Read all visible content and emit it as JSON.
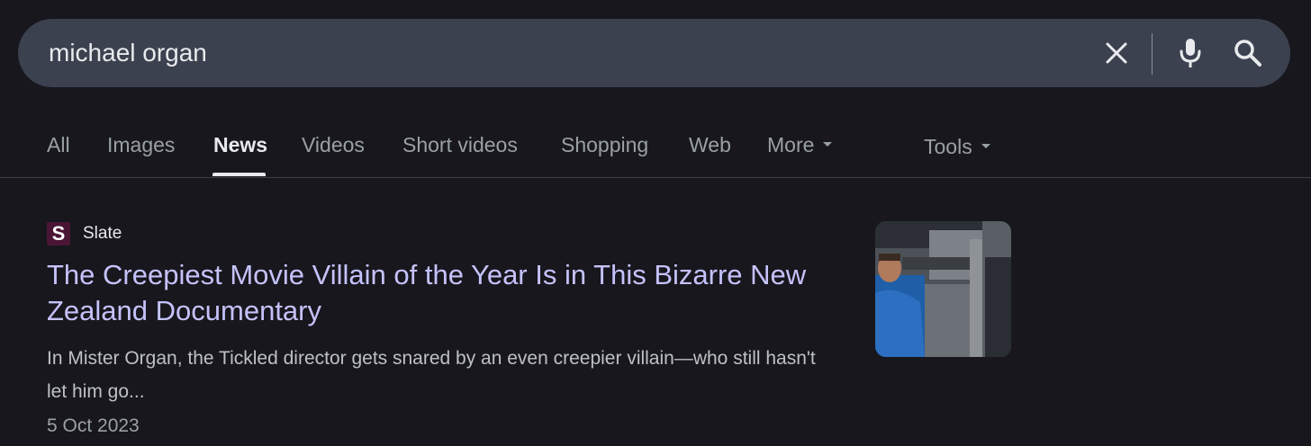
{
  "search": {
    "query": "michael organ",
    "clear_icon": "close-icon",
    "mic_icon": "microphone-icon",
    "search_icon": "search-icon"
  },
  "tabs": [
    {
      "label": "All",
      "active": false
    },
    {
      "label": "Images",
      "active": false
    },
    {
      "label": "News",
      "active": true
    },
    {
      "label": "Videos",
      "active": false
    },
    {
      "label": "Short videos",
      "active": false
    },
    {
      "label": "Shopping",
      "active": false
    },
    {
      "label": "Web",
      "active": false
    },
    {
      "label": "More",
      "active": false
    }
  ],
  "tools": {
    "label": "Tools"
  },
  "result": {
    "source": "Slate",
    "favicon_letter": "S",
    "title": "The Creepiest Movie Villain of the Year Is in This Bizarre New Zealand Documentary",
    "snippet": "In Mister Organ, the Tickled director gets snared by an even creepier villain—who still hasn't let him go...",
    "date": "5 Oct 2023"
  },
  "colors": {
    "background": "#17171d",
    "search_bar": "#3c414f",
    "link": "#c5c2fb",
    "favicon": "#4a1535"
  }
}
